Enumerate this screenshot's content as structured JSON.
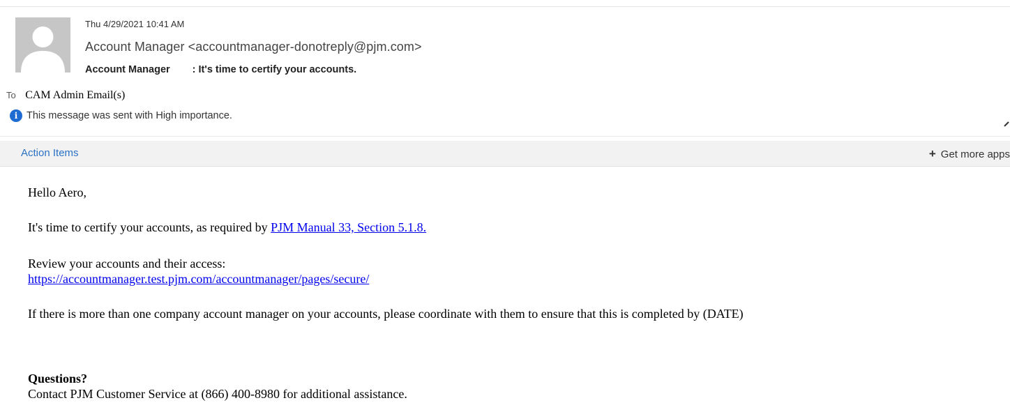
{
  "header": {
    "date": "Thu 4/29/2021 10:41 AM",
    "from": "Account Manager <accountmanager-donotreply@pjm.com>",
    "subject_prefix": "Account Manager",
    "subject_rest": ": It's time to certify your accounts.",
    "to_label": "To",
    "to_value": "CAM Admin Email(s)",
    "importance": "This message was sent with High importance."
  },
  "action_bar": {
    "action_items": "Action Items",
    "get_more_apps": "Get more apps"
  },
  "body": {
    "greeting": "Hello Aero,",
    "certify_text": "It's time to certify your accounts, as required by ",
    "manual_link": "PJM Manual 33, Section 5.1.8.",
    "review_text": "Review your accounts and their access:",
    "review_url": "https://accountmanager.test.pjm.com/accountmanager/pages/secure/",
    "coordinate_text": "If there is more than one company account manager on your accounts, please coordinate with them to ensure that this is completed by  (DATE)",
    "questions_heading": "Questions?",
    "contact_text": "Contact PJM Customer Service at (866) 400-8980 for additional assistance."
  },
  "colors": {
    "link": "#0000ee",
    "accent": "#2a72c4",
    "info_icon": "#1e6bd1"
  },
  "icons": {
    "avatar": "person-silhouette-icon",
    "importance": "info-icon",
    "expand": "chevron-up-icon",
    "add": "plus-icon"
  }
}
